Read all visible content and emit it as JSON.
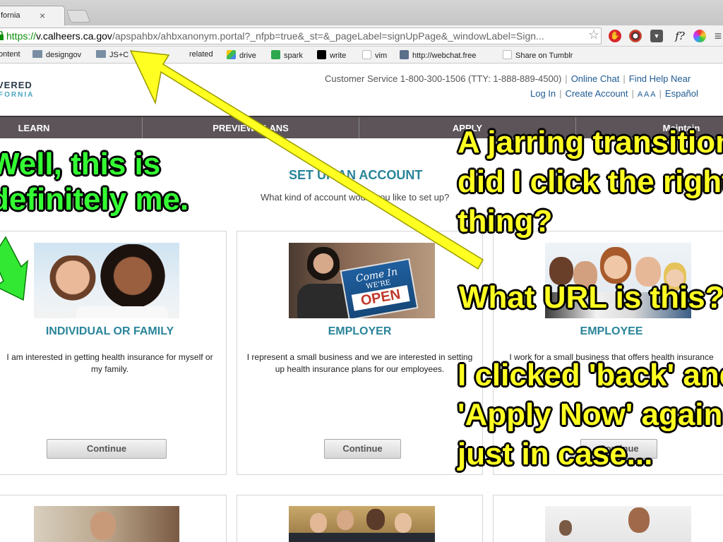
{
  "browser": {
    "tab_title": "fornia",
    "tab_close": "×",
    "url_scheme": "https://",
    "url_domain": "v.calheers.ca.gov",
    "url_path": "/apspahbx/ahbxanonym.portal?_nfpb=true&_st=&_pageLabel=signUpPage&_windowLabel=Sign...",
    "bookmarks": [
      "ontent",
      "designgov",
      "JS+C",
      "related",
      "drive",
      "spark",
      "write",
      "vim",
      "http://webchat.free",
      "Share on Tumblr"
    ],
    "extensions": [
      "star-icon",
      "hand-stop-icon",
      "color-wheel-icon",
      "pocket-icon",
      "function-icon",
      "help-icon",
      "color-picker-icon"
    ],
    "ext_glyphs": [
      "☆",
      "✋",
      "◉",
      "▼",
      "f?",
      "?",
      "✺"
    ]
  },
  "header": {
    "logo_line1": "VERED",
    "logo_line2": "FORNIA",
    "customer_service": "Customer Service 1-800-300-1506 (TTY: 1-888-889-4500)",
    "online_chat": "Online Chat",
    "find_help": "Find Help Near",
    "login": "Log In",
    "create_account": "Create Account",
    "text_size": "A A A",
    "language": "Español"
  },
  "nav": {
    "items": [
      "LEARN",
      "PREVIEW PLANS",
      "APPLY",
      "Maintain"
    ]
  },
  "main": {
    "title": "SET UP AN ACCOUNT",
    "subtitle": "What kind of account would you like to set up?",
    "cards": [
      {
        "title": "INDIVIDUAL OR FAMILY",
        "desc": "I am interested in getting health insurance for myself or my family.",
        "button": "Continue"
      },
      {
        "title": "EMPLOYER",
        "desc": "I represent a small business and we are interested in setting up health insurance plans for our employees.",
        "button": "Continue",
        "sign_top": "Come In",
        "sign_mid": "WE'RE",
        "sign_bottom": "OPEN"
      },
      {
        "title": "EMPLOYEE",
        "desc": "I work for a small business that offers health insurance",
        "button": "Continue"
      }
    ]
  },
  "annotations": {
    "green": [
      "Well, this is",
      "definitely me."
    ],
    "yellow_1": [
      "A jarring transition",
      "did I click the right",
      "thing?"
    ],
    "yellow_2": "What URL is this?",
    "yellow_3": [
      "I clicked 'back' and",
      "'Apply Now' again",
      "just in case..."
    ]
  },
  "colors": {
    "accent_teal": "#29849a",
    "nav_bg": "#5c5459",
    "link_blue": "#1f5a92",
    "annotation_green": "#33ff33",
    "annotation_yellow": "#ffff22"
  }
}
